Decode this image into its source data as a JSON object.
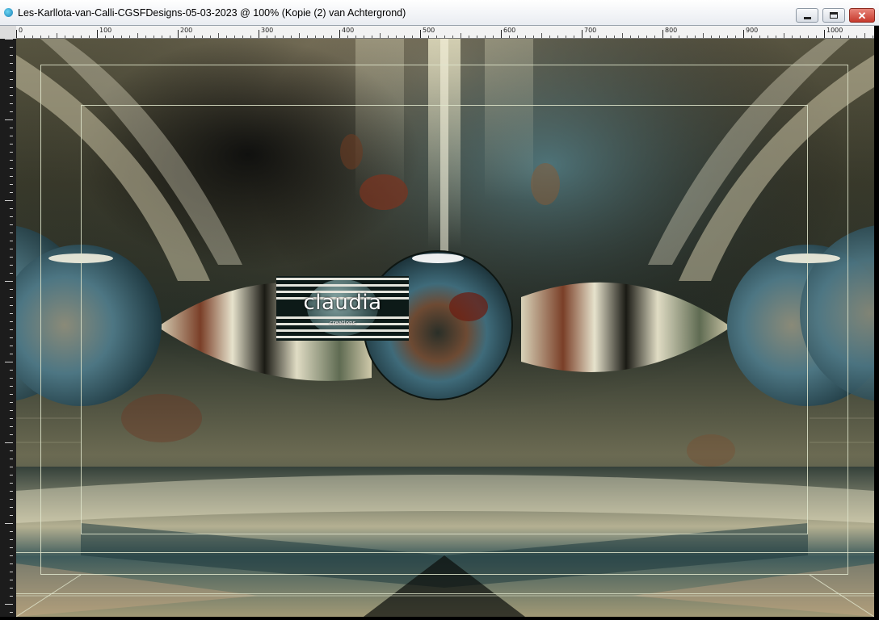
{
  "window": {
    "title": "Les-Karllota-van-Calli-CGSFDesigns-05-03-2023 @ 100% (Kopie (2) van Achtergrond)",
    "app_icon": "psp-app-icon",
    "buttons": {
      "minimize_icon": "minimize-icon",
      "maximize_icon": "restore-icon",
      "close_glyph": "✕"
    }
  },
  "ruler": {
    "labels": [
      "0",
      "100",
      "200",
      "300",
      "400",
      "500",
      "600",
      "700",
      "800",
      "900",
      "1000"
    ]
  },
  "watermark": {
    "text": "claudia",
    "subtext": "creations"
  },
  "colors": {
    "accent_close": "#c6392c",
    "frame_line": "#e1e6cd",
    "sphere_blue": "#3f6b7a",
    "rust": "#8a3a22"
  }
}
